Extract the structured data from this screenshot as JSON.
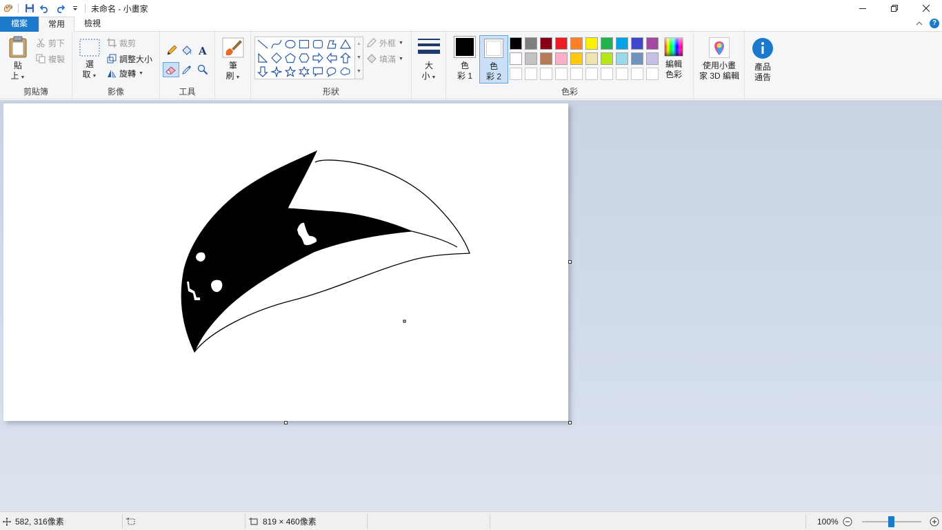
{
  "window": {
    "title": "未命名 - 小畫家"
  },
  "tabs": {
    "file": "檔案",
    "home": "常用",
    "view": "檢視"
  },
  "ribbon": {
    "clipboard": {
      "label": "剪貼簿",
      "paste_line1": "貼",
      "paste_line2": "上",
      "cut": "剪下",
      "copy": "複製"
    },
    "image": {
      "label": "影像",
      "select_line1": "選",
      "select_line2": "取",
      "crop": "裁剪",
      "resize": "調整大小",
      "rotate": "旋轉"
    },
    "tools": {
      "label": "工具"
    },
    "brushes": {
      "line1": "筆",
      "line2": "刷"
    },
    "shapes": {
      "label": "形狀",
      "outline": "外框",
      "fill": "填滿"
    },
    "size": {
      "line1": "大",
      "line2": "小"
    },
    "colors": {
      "label": "色彩",
      "color1_line1": "色",
      "color1_line2": "彩 1",
      "color2_line1": "色",
      "color2_line2": "彩 2",
      "color1_value": "#000000",
      "color2_value": "#ffffff",
      "edit_line1": "編輯",
      "edit_line2": "色彩",
      "palette_row1": [
        "#000000",
        "#7f7f7f",
        "#880015",
        "#ed1c24",
        "#ff7f27",
        "#fff200",
        "#22b14c",
        "#00a2e8",
        "#3f48cc",
        "#a349a4"
      ],
      "palette_row2": [
        "#ffffff",
        "#c3c3c3",
        "#b97a57",
        "#ffaec9",
        "#ffc90e",
        "#efe4b0",
        "#b5e61d",
        "#99d9ea",
        "#7092be",
        "#c8bfe7"
      ]
    },
    "paint3d": {
      "line1": "使用小畫",
      "line2": "家 3D 編輯"
    },
    "product_alert": {
      "line1": "產品",
      "line2": "通告"
    }
  },
  "status": {
    "cursor_position": "582, 316像素",
    "image_size": "819 × 460像素",
    "zoom": "100%"
  }
}
